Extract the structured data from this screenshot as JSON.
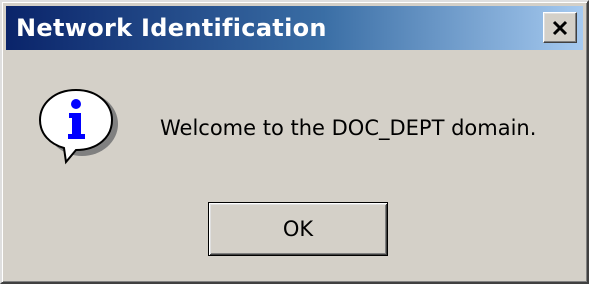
{
  "window": {
    "title": "Network Identification",
    "close_icon": "close-x-icon"
  },
  "dialog": {
    "icon": "information-icon",
    "message": "Welcome to the DOC_DEPT domain.",
    "ok_label": "OK"
  },
  "colors": {
    "title_gradient_start": "#0a246a",
    "title_gradient_end": "#a6caf0",
    "face": "#d4d0c8",
    "info_blue": "#0000ff"
  }
}
